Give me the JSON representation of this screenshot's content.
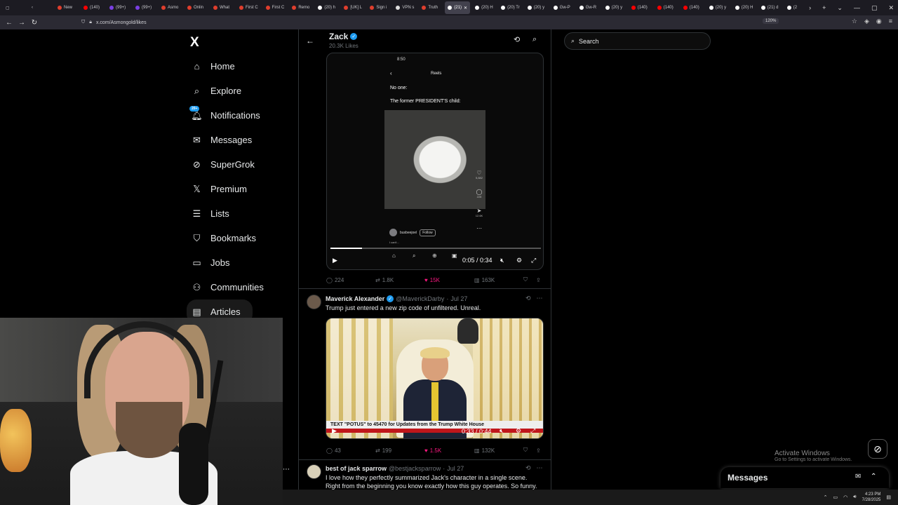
{
  "browser": {
    "tabs": [
      {
        "label": "New",
        "color": "#e03e2d"
      },
      {
        "label": "(140)",
        "color": "#ff0000"
      },
      {
        "label": "(99+)",
        "color": "#7b3fe4"
      },
      {
        "label": "(99+)",
        "color": "#7b3fe4"
      },
      {
        "label": "Asmo",
        "color": "#e03e2d"
      },
      {
        "label": "Onlin",
        "color": "#e03e2d"
      },
      {
        "label": "What",
        "color": "#e03e2d"
      },
      {
        "label": "First C",
        "color": "#e03e2d"
      },
      {
        "label": "First C",
        "color": "#e03e2d"
      },
      {
        "label": "Remo",
        "color": "#e03e2d"
      },
      {
        "label": "(20) h",
        "color": "#ffffff"
      },
      {
        "label": "[UK] L",
        "color": "#e03e2d"
      },
      {
        "label": "Sign i",
        "color": "#e03e2d"
      },
      {
        "label": "VPN s",
        "color": "#dddddd"
      },
      {
        "label": "Truth",
        "color": "#e03e2d"
      },
      {
        "label": "(21)",
        "color": "#ffffff",
        "active": true
      },
      {
        "label": "(20) H",
        "color": "#ffffff"
      },
      {
        "label": "(20) Tr",
        "color": "#ffffff"
      },
      {
        "label": "(20) y",
        "color": "#ffffff"
      },
      {
        "label": "Gw-P",
        "color": "#ffffff"
      },
      {
        "label": "Gw-R",
        "color": "#ffffff"
      },
      {
        "label": "(20) y",
        "color": "#ffffff"
      },
      {
        "label": "(140)",
        "color": "#ff0000"
      },
      {
        "label": "(140)",
        "color": "#ff0000"
      },
      {
        "label": "(140)",
        "color": "#ff0000"
      },
      {
        "label": "(20) y",
        "color": "#ffffff"
      },
      {
        "label": "(20) H",
        "color": "#ffffff"
      },
      {
        "label": "(21) d",
        "color": "#ffffff"
      },
      {
        "label": "(2",
        "color": "#ffffff"
      }
    ],
    "url": "x.com/Asmongold/likes",
    "zoom": "120%"
  },
  "nav": {
    "logo": "X",
    "items": [
      {
        "label": "Home",
        "icon": "home-icon"
      },
      {
        "label": "Explore",
        "icon": "search-icon"
      },
      {
        "label": "Notifications",
        "icon": "bell-icon",
        "badge": "20+"
      },
      {
        "label": "Messages",
        "icon": "mail-icon"
      },
      {
        "label": "SuperGrok",
        "icon": "grok-icon"
      },
      {
        "label": "Premium",
        "icon": "x-icon"
      },
      {
        "label": "Lists",
        "icon": "list-icon"
      },
      {
        "label": "Bookmarks",
        "icon": "bookmark-icon"
      },
      {
        "label": "Jobs",
        "icon": "briefcase-icon"
      },
      {
        "label": "Communities",
        "icon": "people-icon"
      },
      {
        "label": "Articles",
        "icon": "article-icon"
      }
    ]
  },
  "header": {
    "title": "Zack",
    "subtitle": "20.3K Likes"
  },
  "post1": {
    "phone_time": "8:50",
    "reels_title": "Reels",
    "caption_line1": "No one:",
    "caption_line2": "The former PRESIDENT'S child:",
    "rail": [
      {
        "icon": "♡",
        "count": "5,882"
      },
      {
        "icon": "◯",
        "count": "228"
      },
      {
        "icon": "➤",
        "count": "12.6K"
      },
      {
        "icon": "⋯",
        "count": ""
      }
    ],
    "reel_user": "busbeejoel",
    "reel_follow": "Follow",
    "reel_text": "I can't...",
    "video_time": "0:05 / 0:34",
    "progress": 0.15,
    "stats": {
      "replies": "224",
      "reposts": "1.8K",
      "likes": "15K",
      "views": "163K"
    }
  },
  "post2": {
    "name": "Maverick Alexander",
    "handle": "@MaverickDarby",
    "date": "Jul 27",
    "text": "Trump just entered a new zip code of unfiltered. Unreal.",
    "chyron": "TEXT \"POTUS\" to 45470 for Updates from the Trump White House",
    "video_time": "0:33 / 0:44",
    "stats": {
      "replies": "43",
      "reposts": "199",
      "likes": "1.5K",
      "views": "132K"
    }
  },
  "post3": {
    "name": "best of jack sparrow",
    "handle": "@bestjacksparrow",
    "date": "Jul 27",
    "text_line1": "I love how they perfectly summarized Jack's character in a single scene.",
    "text_line2": "Right from the beginning you know exactly how this guy operates. So funny."
  },
  "right": {
    "search_placeholder": "Search",
    "messages_label": "Messages"
  },
  "windows": {
    "activate_title": "Activate Windows",
    "activate_sub": "Go to Settings to activate Windows.",
    "time": "4:23 PM",
    "date": "7/28/2025"
  },
  "colors": {
    "accent": "#1d9bf0",
    "like": "#f91880",
    "muted": "#71767b"
  }
}
